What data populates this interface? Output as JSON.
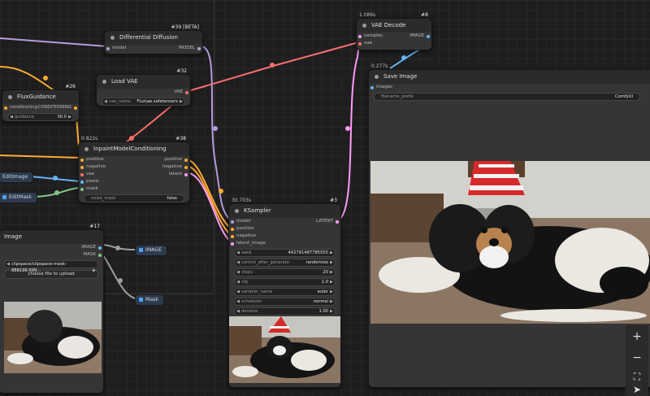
{
  "colors": {
    "model": "#b39ddb",
    "vae": "#ff6e6e",
    "conditioning": "#ffa931",
    "latent": "#ff9cf9",
    "image": "#64b5f6",
    "mask": "#81c784"
  },
  "nodes": {
    "differential_diffusion": {
      "id": "#39 [BETA]",
      "title": "Differential Diffusion",
      "inputs": [
        "model"
      ],
      "outputs": [
        "MODEL"
      ]
    },
    "load_vae": {
      "id": "#32",
      "title": "Load VAE",
      "outputs": [
        "VAE"
      ],
      "widget": {
        "label": "vae_name",
        "value": "Flux\\ae.safetensors"
      }
    },
    "flux_guidance": {
      "id": "#26",
      "title": "FluxGuidance",
      "inputs": [
        "conditioning"
      ],
      "outputs": [
        "CONDITIONING"
      ],
      "widget": {
        "label": "guidance",
        "value": "30.0"
      }
    },
    "inpaint": {
      "id": "#38",
      "timer": "0.822s",
      "title": "InpaintModelConditioning",
      "inputs": [
        "positive",
        "negative",
        "vae",
        "pixels",
        "mask"
      ],
      "outputs": [
        "positive",
        "negative",
        "latent"
      ],
      "widget": {
        "label": "noise_mask",
        "value": "false"
      }
    },
    "load_image": {
      "id": "#17",
      "title": "Image",
      "outputs": [
        "IMAGE",
        "MASK"
      ],
      "file": "clipspace/clipspace-mask-888196.699...",
      "upload": "choose file to upload"
    },
    "vae_decode": {
      "id": "#8",
      "timer": "1.086s",
      "title": "VAE Decode",
      "inputs": [
        "samples",
        "vae"
      ],
      "outputs": [
        "IMAGE"
      ]
    },
    "save_image": {
      "timer": "0.277s",
      "title": "Save Image",
      "inputs": [
        "images"
      ],
      "widget": {
        "label": "filename_prefix",
        "value": "ComfyUI"
      }
    },
    "ksampler": {
      "id": "#3",
      "timer": "30.703s",
      "title": "KSampler",
      "inputs": [
        "model",
        "positive",
        "negative",
        "latent_image"
      ],
      "outputs": [
        "LATENT"
      ],
      "widgets": [
        {
          "label": "seed",
          "value": "442791487785555"
        },
        {
          "label": "control_after_generate",
          "value": "randomize"
        },
        {
          "label": "steps",
          "value": "20"
        },
        {
          "label": "cfg",
          "value": "1.0"
        },
        {
          "label": "sampler_name",
          "value": "euler"
        },
        {
          "label": "scheduler",
          "value": "normal"
        },
        {
          "label": "denoise",
          "value": "1.00"
        }
      ]
    }
  },
  "chips": {
    "edit_image": "EditImage",
    "edit_mask": "EditMask",
    "image_out": "IMAGE",
    "mask_out": "Mask"
  },
  "toolbar": {
    "zoom_in": "+",
    "zoom_out": "−",
    "fit": "⛶",
    "pointer": "➤"
  },
  "icons": [
    "plus-icon",
    "minus-icon",
    "fit-view-icon",
    "pointer-icon"
  ]
}
